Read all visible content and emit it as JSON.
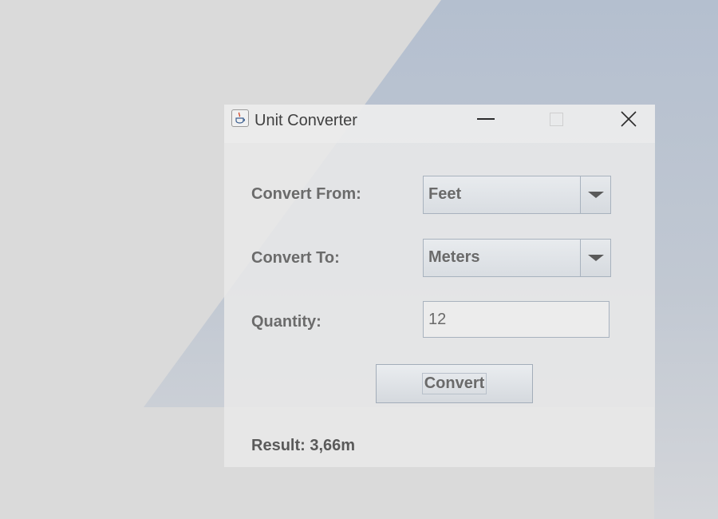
{
  "window": {
    "title": "Unit Converter",
    "app_icon": "java-cup-icon",
    "controls": {
      "minimize_icon": "minimize-icon",
      "maximize_icon": "maximize-icon",
      "close_icon": "close-icon",
      "close_glyph": "✕"
    }
  },
  "form": {
    "from_label": "Convert From:",
    "from_value": "Feet",
    "to_label": "Convert To:",
    "to_value": "Meters",
    "quantity_label": "Quantity:",
    "quantity_value": "12",
    "convert_label": "Convert",
    "result_text": "Result: 3,66m"
  },
  "colors": {
    "desktop_bg": "#dadada",
    "wallpaper_accent": "#b4bfcf",
    "window_bg": "#e9e9e9",
    "label_text": "#6b6b6b"
  }
}
